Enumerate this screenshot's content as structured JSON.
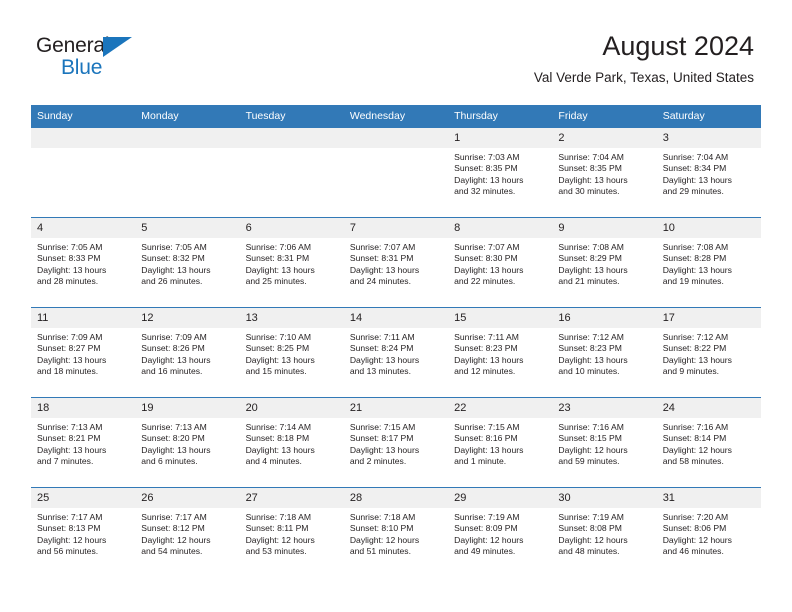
{
  "brand": {
    "name_part1": "General",
    "name_part2": "Blue",
    "accent_color": "#1b75bc"
  },
  "header": {
    "title": "August 2024",
    "subtitle": "Val Verde Park, Texas, United States",
    "header_bg_color": "#3279b7",
    "daynum_band_color": "#f0f0f0"
  },
  "weekday_headers": [
    "Sunday",
    "Monday",
    "Tuesday",
    "Wednesday",
    "Thursday",
    "Friday",
    "Saturday"
  ],
  "weeks": [
    [
      {
        "day": "",
        "sunrise": "",
        "sunset": "",
        "daylight_l1": "",
        "daylight_l2": ""
      },
      {
        "day": "",
        "sunrise": "",
        "sunset": "",
        "daylight_l1": "",
        "daylight_l2": ""
      },
      {
        "day": "",
        "sunrise": "",
        "sunset": "",
        "daylight_l1": "",
        "daylight_l2": ""
      },
      {
        "day": "",
        "sunrise": "",
        "sunset": "",
        "daylight_l1": "",
        "daylight_l2": ""
      },
      {
        "day": "1",
        "sunrise": "Sunrise: 7:03 AM",
        "sunset": "Sunset: 8:35 PM",
        "daylight_l1": "Daylight: 13 hours",
        "daylight_l2": "and 32 minutes."
      },
      {
        "day": "2",
        "sunrise": "Sunrise: 7:04 AM",
        "sunset": "Sunset: 8:35 PM",
        "daylight_l1": "Daylight: 13 hours",
        "daylight_l2": "and 30 minutes."
      },
      {
        "day": "3",
        "sunrise": "Sunrise: 7:04 AM",
        "sunset": "Sunset: 8:34 PM",
        "daylight_l1": "Daylight: 13 hours",
        "daylight_l2": "and 29 minutes."
      }
    ],
    [
      {
        "day": "4",
        "sunrise": "Sunrise: 7:05 AM",
        "sunset": "Sunset: 8:33 PM",
        "daylight_l1": "Daylight: 13 hours",
        "daylight_l2": "and 28 minutes."
      },
      {
        "day": "5",
        "sunrise": "Sunrise: 7:05 AM",
        "sunset": "Sunset: 8:32 PM",
        "daylight_l1": "Daylight: 13 hours",
        "daylight_l2": "and 26 minutes."
      },
      {
        "day": "6",
        "sunrise": "Sunrise: 7:06 AM",
        "sunset": "Sunset: 8:31 PM",
        "daylight_l1": "Daylight: 13 hours",
        "daylight_l2": "and 25 minutes."
      },
      {
        "day": "7",
        "sunrise": "Sunrise: 7:07 AM",
        "sunset": "Sunset: 8:31 PM",
        "daylight_l1": "Daylight: 13 hours",
        "daylight_l2": "and 24 minutes."
      },
      {
        "day": "8",
        "sunrise": "Sunrise: 7:07 AM",
        "sunset": "Sunset: 8:30 PM",
        "daylight_l1": "Daylight: 13 hours",
        "daylight_l2": "and 22 minutes."
      },
      {
        "day": "9",
        "sunrise": "Sunrise: 7:08 AM",
        "sunset": "Sunset: 8:29 PM",
        "daylight_l1": "Daylight: 13 hours",
        "daylight_l2": "and 21 minutes."
      },
      {
        "day": "10",
        "sunrise": "Sunrise: 7:08 AM",
        "sunset": "Sunset: 8:28 PM",
        "daylight_l1": "Daylight: 13 hours",
        "daylight_l2": "and 19 minutes."
      }
    ],
    [
      {
        "day": "11",
        "sunrise": "Sunrise: 7:09 AM",
        "sunset": "Sunset: 8:27 PM",
        "daylight_l1": "Daylight: 13 hours",
        "daylight_l2": "and 18 minutes."
      },
      {
        "day": "12",
        "sunrise": "Sunrise: 7:09 AM",
        "sunset": "Sunset: 8:26 PM",
        "daylight_l1": "Daylight: 13 hours",
        "daylight_l2": "and 16 minutes."
      },
      {
        "day": "13",
        "sunrise": "Sunrise: 7:10 AM",
        "sunset": "Sunset: 8:25 PM",
        "daylight_l1": "Daylight: 13 hours",
        "daylight_l2": "and 15 minutes."
      },
      {
        "day": "14",
        "sunrise": "Sunrise: 7:11 AM",
        "sunset": "Sunset: 8:24 PM",
        "daylight_l1": "Daylight: 13 hours",
        "daylight_l2": "and 13 minutes."
      },
      {
        "day": "15",
        "sunrise": "Sunrise: 7:11 AM",
        "sunset": "Sunset: 8:23 PM",
        "daylight_l1": "Daylight: 13 hours",
        "daylight_l2": "and 12 minutes."
      },
      {
        "day": "16",
        "sunrise": "Sunrise: 7:12 AM",
        "sunset": "Sunset: 8:23 PM",
        "daylight_l1": "Daylight: 13 hours",
        "daylight_l2": "and 10 minutes."
      },
      {
        "day": "17",
        "sunrise": "Sunrise: 7:12 AM",
        "sunset": "Sunset: 8:22 PM",
        "daylight_l1": "Daylight: 13 hours",
        "daylight_l2": "and 9 minutes."
      }
    ],
    [
      {
        "day": "18",
        "sunrise": "Sunrise: 7:13 AM",
        "sunset": "Sunset: 8:21 PM",
        "daylight_l1": "Daylight: 13 hours",
        "daylight_l2": "and 7 minutes."
      },
      {
        "day": "19",
        "sunrise": "Sunrise: 7:13 AM",
        "sunset": "Sunset: 8:20 PM",
        "daylight_l1": "Daylight: 13 hours",
        "daylight_l2": "and 6 minutes."
      },
      {
        "day": "20",
        "sunrise": "Sunrise: 7:14 AM",
        "sunset": "Sunset: 8:18 PM",
        "daylight_l1": "Daylight: 13 hours",
        "daylight_l2": "and 4 minutes."
      },
      {
        "day": "21",
        "sunrise": "Sunrise: 7:15 AM",
        "sunset": "Sunset: 8:17 PM",
        "daylight_l1": "Daylight: 13 hours",
        "daylight_l2": "and 2 minutes."
      },
      {
        "day": "22",
        "sunrise": "Sunrise: 7:15 AM",
        "sunset": "Sunset: 8:16 PM",
        "daylight_l1": "Daylight: 13 hours",
        "daylight_l2": "and 1 minute."
      },
      {
        "day": "23",
        "sunrise": "Sunrise: 7:16 AM",
        "sunset": "Sunset: 8:15 PM",
        "daylight_l1": "Daylight: 12 hours",
        "daylight_l2": "and 59 minutes."
      },
      {
        "day": "24",
        "sunrise": "Sunrise: 7:16 AM",
        "sunset": "Sunset: 8:14 PM",
        "daylight_l1": "Daylight: 12 hours",
        "daylight_l2": "and 58 minutes."
      }
    ],
    [
      {
        "day": "25",
        "sunrise": "Sunrise: 7:17 AM",
        "sunset": "Sunset: 8:13 PM",
        "daylight_l1": "Daylight: 12 hours",
        "daylight_l2": "and 56 minutes."
      },
      {
        "day": "26",
        "sunrise": "Sunrise: 7:17 AM",
        "sunset": "Sunset: 8:12 PM",
        "daylight_l1": "Daylight: 12 hours",
        "daylight_l2": "and 54 minutes."
      },
      {
        "day": "27",
        "sunrise": "Sunrise: 7:18 AM",
        "sunset": "Sunset: 8:11 PM",
        "daylight_l1": "Daylight: 12 hours",
        "daylight_l2": "and 53 minutes."
      },
      {
        "day": "28",
        "sunrise": "Sunrise: 7:18 AM",
        "sunset": "Sunset: 8:10 PM",
        "daylight_l1": "Daylight: 12 hours",
        "daylight_l2": "and 51 minutes."
      },
      {
        "day": "29",
        "sunrise": "Sunrise: 7:19 AM",
        "sunset": "Sunset: 8:09 PM",
        "daylight_l1": "Daylight: 12 hours",
        "daylight_l2": "and 49 minutes."
      },
      {
        "day": "30",
        "sunrise": "Sunrise: 7:19 AM",
        "sunset": "Sunset: 8:08 PM",
        "daylight_l1": "Daylight: 12 hours",
        "daylight_l2": "and 48 minutes."
      },
      {
        "day": "31",
        "sunrise": "Sunrise: 7:20 AM",
        "sunset": "Sunset: 8:06 PM",
        "daylight_l1": "Daylight: 12 hours",
        "daylight_l2": "and 46 minutes."
      }
    ]
  ]
}
